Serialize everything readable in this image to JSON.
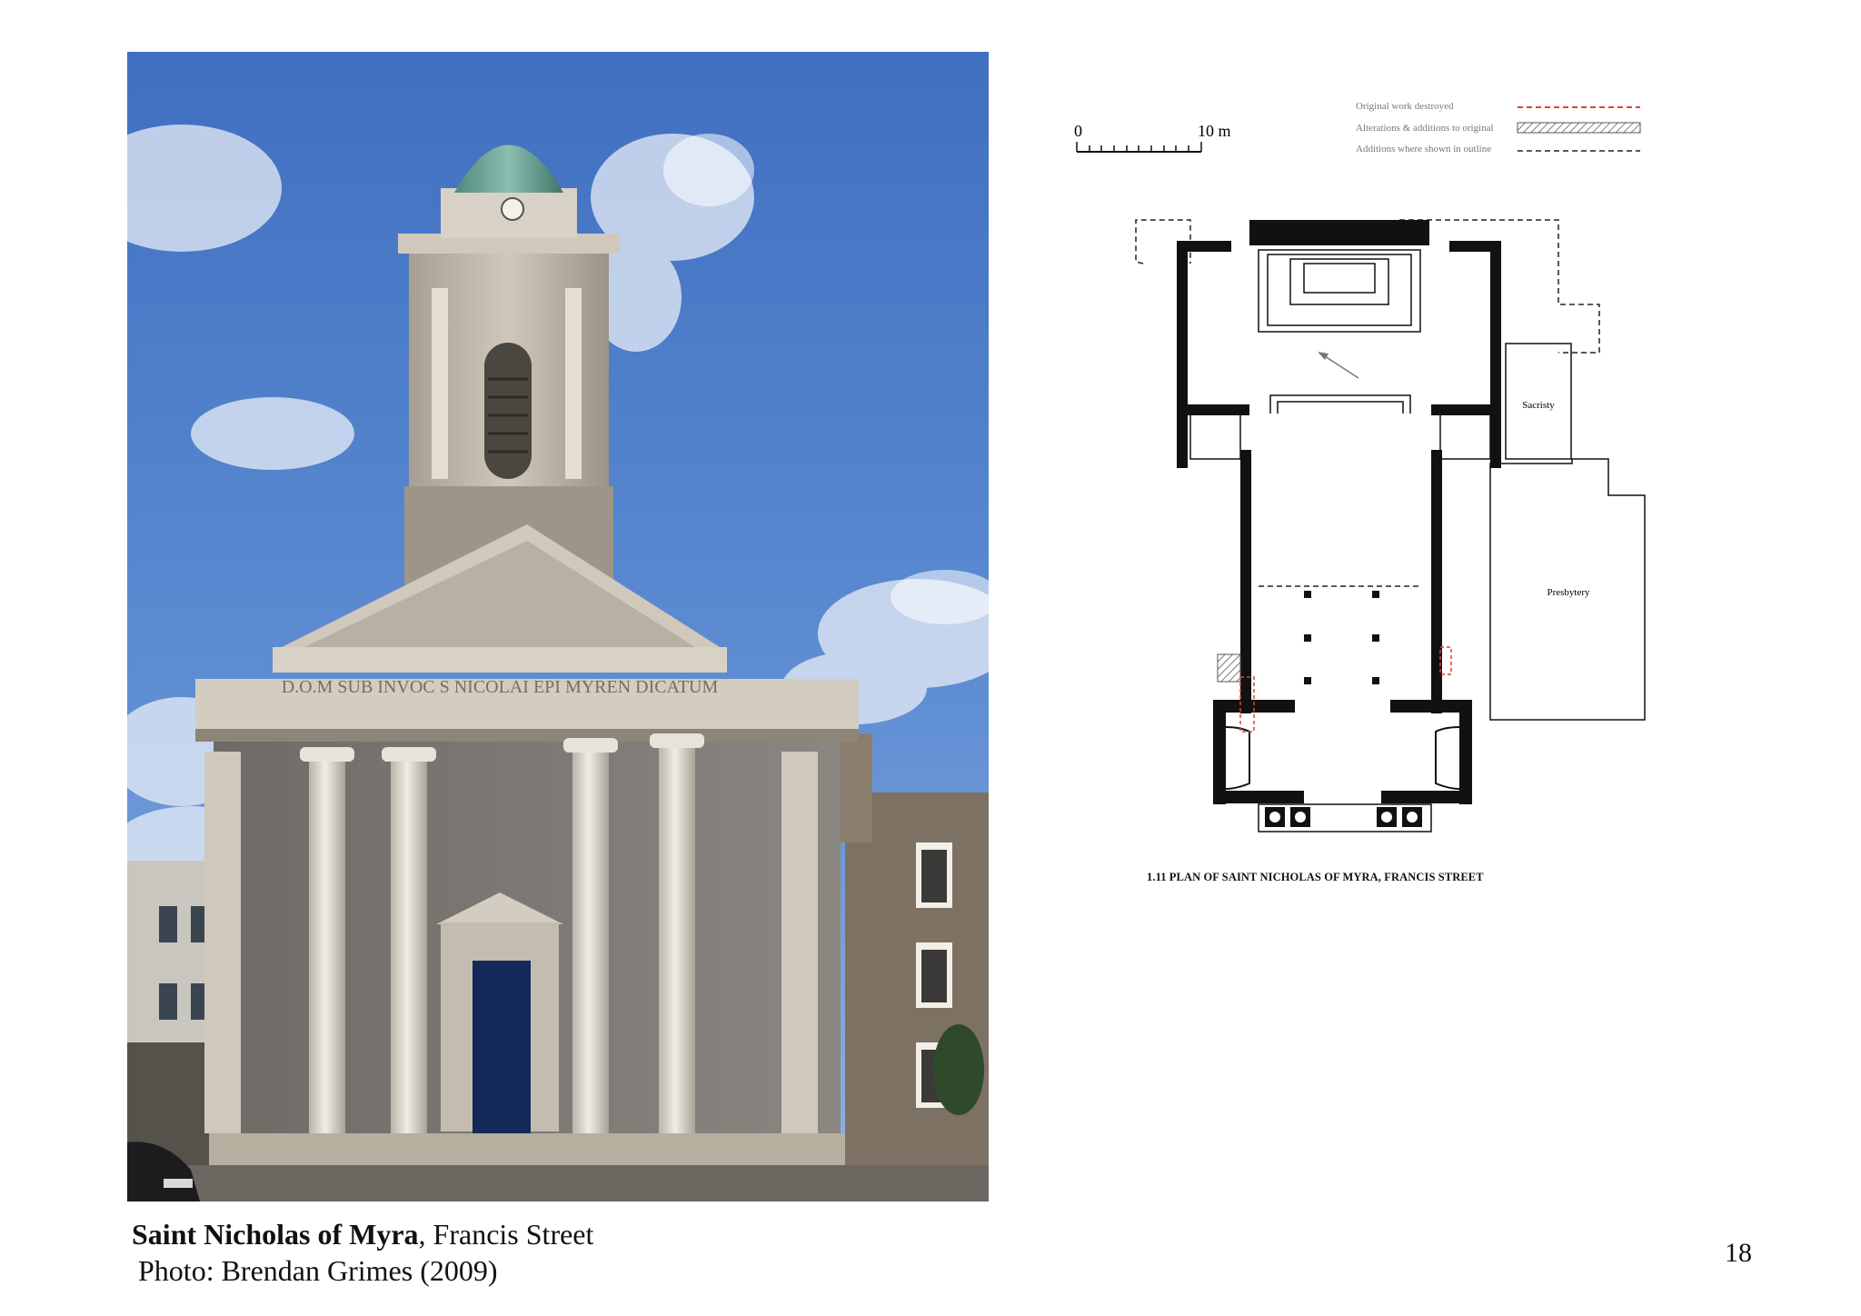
{
  "photo": {
    "pediment_inscription": "D.O.M SUB INVOC S NICOLAI EPI MYREN DICATUM"
  },
  "caption": {
    "title": "Saint Nicholas of Myra",
    "title_suffix": ", Francis Street",
    "credit": "Photo: Brendan Grimes (2009)"
  },
  "page_number": "18",
  "plan": {
    "scale": {
      "start": "0",
      "end": "10 m"
    },
    "legend": [
      {
        "label": "Original work destroyed",
        "style": "red-dashed",
        "color": "#d9423c"
      },
      {
        "label": "Alterations & additions to original",
        "style": "hatched",
        "color": "#555555"
      },
      {
        "label": "Additions where shown in outline",
        "style": "black-dashed",
        "color": "#222222"
      }
    ],
    "rooms": {
      "sacristy": "Sacristy",
      "presbytery": "Presbytery"
    },
    "caption": "1.11   PLAN OF SAINT NICHOLAS OF MYRA, FRANCIS STREET"
  }
}
